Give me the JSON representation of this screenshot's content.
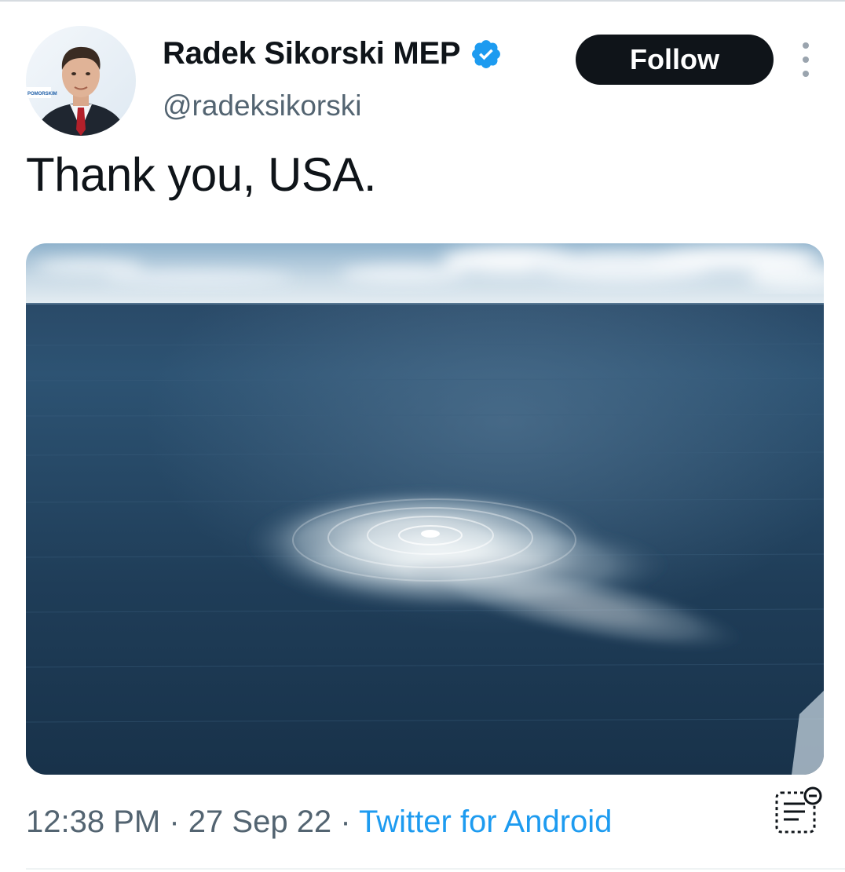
{
  "author": {
    "display_name": "Radek Sikorski MEP",
    "handle": "@radeksikorski",
    "verified": true,
    "avatar_backdrop_text": "POMORSKIM"
  },
  "actions": {
    "follow_label": "Follow",
    "more_icon": "more-vertical-icon"
  },
  "tweet": {
    "text": "Thank you, USA."
  },
  "media": {
    "icon": "photo",
    "accent_sea": "#1f3a52",
    "foam": "#f4f7f8"
  },
  "meta": {
    "time": "12:38 PM",
    "separator": "·",
    "date": "27 Sep 22",
    "source": "Twitter for Android",
    "analytics_icon": "analytics-icon"
  },
  "colors": {
    "text_primary": "#0f1419",
    "text_secondary": "#536471",
    "link": "#1d9bf0",
    "verified": "#1d9bf0",
    "follow_bg": "#0f1419"
  }
}
